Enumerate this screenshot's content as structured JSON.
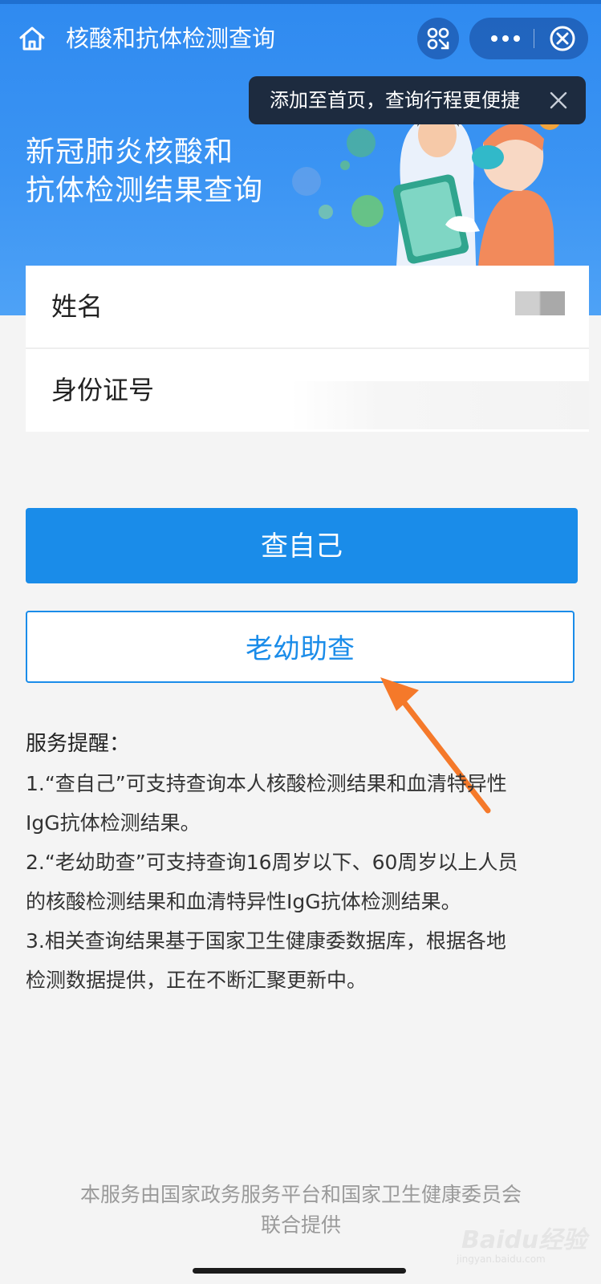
{
  "nav": {
    "title": "核酸和抗体检测查询"
  },
  "tooltip": {
    "text": "添加至首页，查询行程更便捷"
  },
  "banner": {
    "line1": "新冠肺炎核酸和",
    "line2": "抗体检测结果查询"
  },
  "form": {
    "name_label": "姓名",
    "id_label": "身份证号"
  },
  "buttons": {
    "self_query": "查自己",
    "assist_query": "老幼助查"
  },
  "notice": {
    "title": "服务提醒：",
    "item1_line1": "1.“查自己”可支持查询本人核酸检测结果和血清特异性",
    "item1_line2": "IgG抗体检测结果。",
    "item2_line1": "2.“老幼助查”可支持查询16周岁以下、60周岁以上人员",
    "item2_line2": "的核酸检测结果和血清特异性IgG抗体检测结果。",
    "item3_line1": "3.相关查询结果基于国家卫生健康委数据库，根据各地",
    "item3_line2": "检测数据提供，正在不断汇聚更新中。"
  },
  "footer": {
    "line1": "本服务由国家政务服务平台和国家卫生健康委员会",
    "line2": "联合提供"
  },
  "watermark": {
    "main": "Baidu经验",
    "sub": "jingyan.baidu.com"
  },
  "icons": {
    "home": "home-icon",
    "scan": "scan-icon",
    "more": "more-icon",
    "close": "close-circle-icon",
    "tooltip_close": "close-icon"
  },
  "colors": {
    "header_blue": "#2f8af0",
    "primary_button": "#1a8ce9",
    "annotation_arrow": "#f5792a"
  }
}
